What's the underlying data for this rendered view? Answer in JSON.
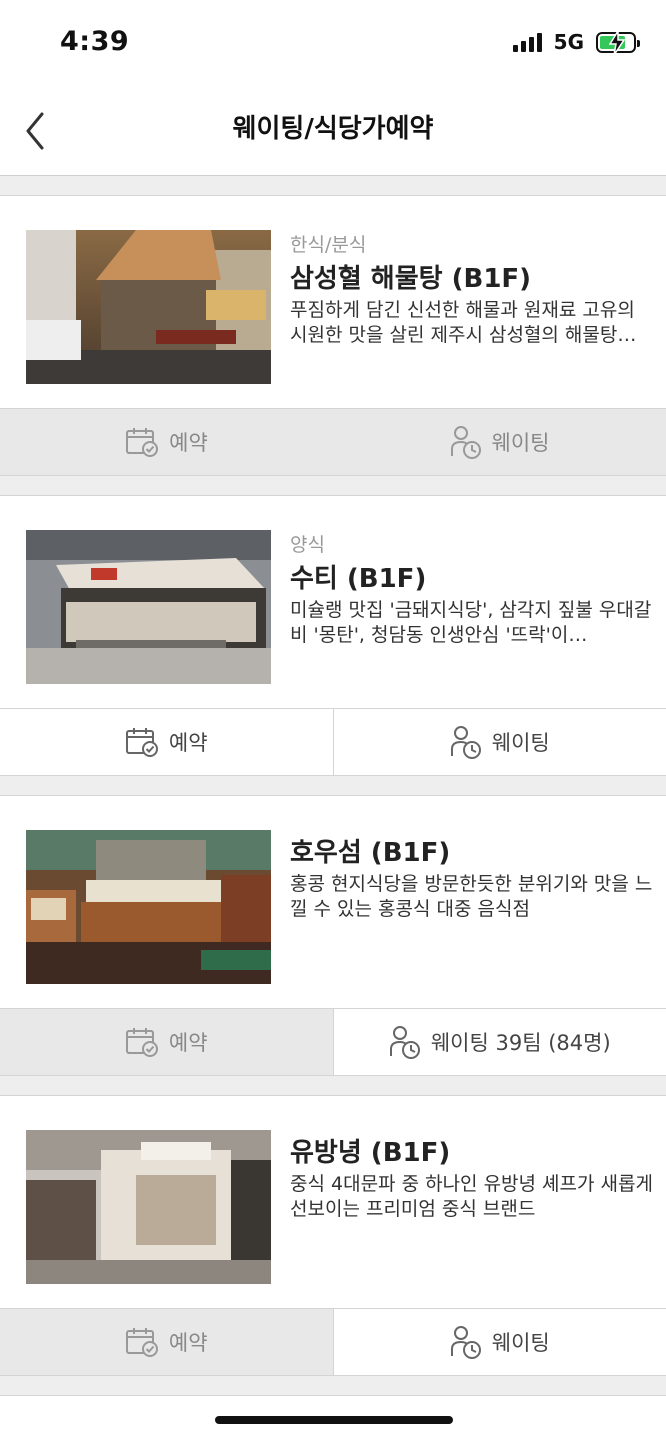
{
  "status_bar": {
    "time": "4:39",
    "network": "5G"
  },
  "header": {
    "title": "웨이팅/식당가예약"
  },
  "restaurants": [
    {
      "category": "한식/분식",
      "name": "삼성혈 해물탕 (B1F)",
      "description": "푸짐하게 담긴 신선한 해물과 원재료 고유의 시원한 맛을 살린 제주시 삼성혈의 해물탕…",
      "reserve_label": "예약",
      "waiting_label": "웨이팅"
    },
    {
      "category": "양식",
      "name": "수티 (B1F)",
      "description": "미슐랭 맛집 '금돼지식당', 삼각지 짚불 우대갈비 '몽탄', 청담동 인생안심 '뜨락'이…",
      "reserve_label": "예약",
      "waiting_label": "웨이팅"
    },
    {
      "category": "",
      "name": "호우섬 (B1F)",
      "description": "홍콩 현지식당을 방문한듯한 분위기와 맛을 느낄 수 있는 홍콩식 대중 음식점",
      "reserve_label": "예약",
      "waiting_label": "웨이팅 39팀 (84명)"
    },
    {
      "category": "",
      "name": "유방녕 (B1F)",
      "description": "중식 4대문파 중 하나인 유방녕 셰프가 새롭게 선보이는 프리미엄 중식 브랜드",
      "reserve_label": "예약",
      "waiting_label": "웨이팅"
    }
  ],
  "colors": {
    "battery": "#34c759",
    "button_disabled_bg": "#e8e8e8",
    "divider": "#d4d4d4"
  },
  "icons": [
    "back-chevron-icon",
    "calendar-check-icon",
    "person-clock-icon",
    "battery-charging-icon",
    "signal-icon"
  ]
}
